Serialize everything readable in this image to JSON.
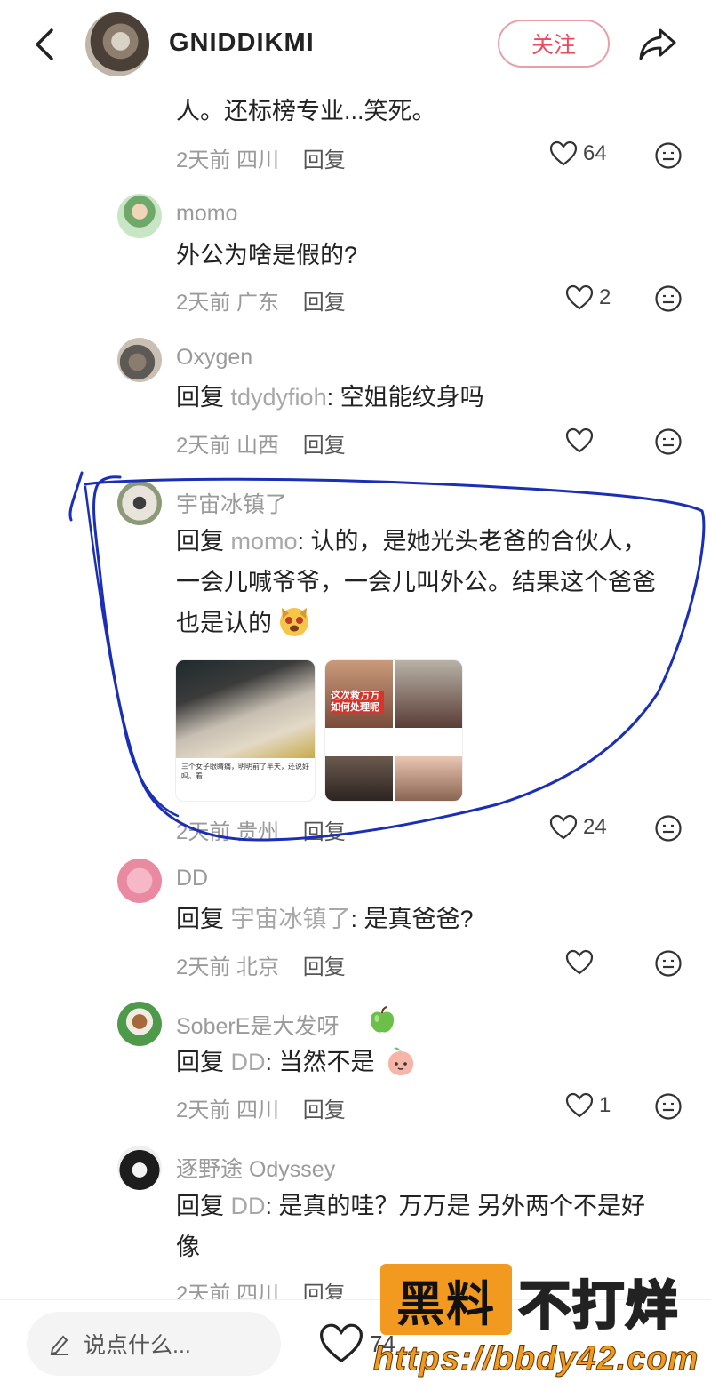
{
  "header": {
    "author": "GNIDDIKMI",
    "follow_label": "关注",
    "icons": [
      "back-icon",
      "share-icon"
    ]
  },
  "comments": [
    {
      "text": "人。还标榜专业...笑死。",
      "time": "2天前",
      "region": "四川",
      "reply_label": "回复",
      "likes": "64"
    },
    {
      "user": "momo",
      "text": "外公为啥是假的?",
      "time": "2天前",
      "region": "广东",
      "reply_label": "回复",
      "likes": "2"
    },
    {
      "user": "Oxygen",
      "reply_prefix": "回复",
      "mention": "tdydyfioh",
      "text": ": 空姐能纹身吗",
      "time": "2天前",
      "region": "山西",
      "reply_label": "回复",
      "likes": ""
    },
    {
      "user": "宇宙冰镇了",
      "reply_prefix": "回复",
      "mention": "momo",
      "text_lines": [
        ": 认的，是她光头老爸的合伙人，",
        "一会儿喊爷爷，一会儿叫外公。结果这个爸爸",
        "也是认的"
      ],
      "emoji": "dog-face-emoji",
      "time": "2天前",
      "region": "贵州",
      "reply_label": "回复",
      "likes": "24",
      "images": {
        "a_caption": "三个女子眼睛痛，明明前了半天，还说好吗。看",
        "b_banner": "这次救万万\n如何处理呢"
      }
    },
    {
      "user": "DD",
      "reply_prefix": "回复",
      "mention": "宇宙冰镇了",
      "text": ": 是真爸爸?",
      "time": "2天前",
      "region": "北京",
      "reply_label": "回复",
      "likes": ""
    },
    {
      "user": "SoberE是大发呀",
      "user_emoji": "green-apple-emoji",
      "reply_prefix": "回复",
      "mention": "DD",
      "text": ": 当然不是",
      "emoji": "peach-face-emoji",
      "time": "2天前",
      "region": "四川",
      "reply_label": "回复",
      "likes": "1"
    },
    {
      "user": "逐野途 Odyssey",
      "reply_prefix": "回复",
      "mention": "DD",
      "text_lines": [
        ": 是真的哇？万万是 另外两个不是好",
        "像"
      ],
      "time": "2天前",
      "region": "四川",
      "reply_label": "回复"
    }
  ],
  "bottom": {
    "placeholder": "说点什么...",
    "likes": "74"
  },
  "watermark": {
    "box": "黑料",
    "text": "不打烊",
    "url": "https://bbdy42.com"
  },
  "colors": {
    "accent": "#ea4a5c",
    "annotation": "#1a2fb5",
    "watermark": "#f29a1f"
  }
}
